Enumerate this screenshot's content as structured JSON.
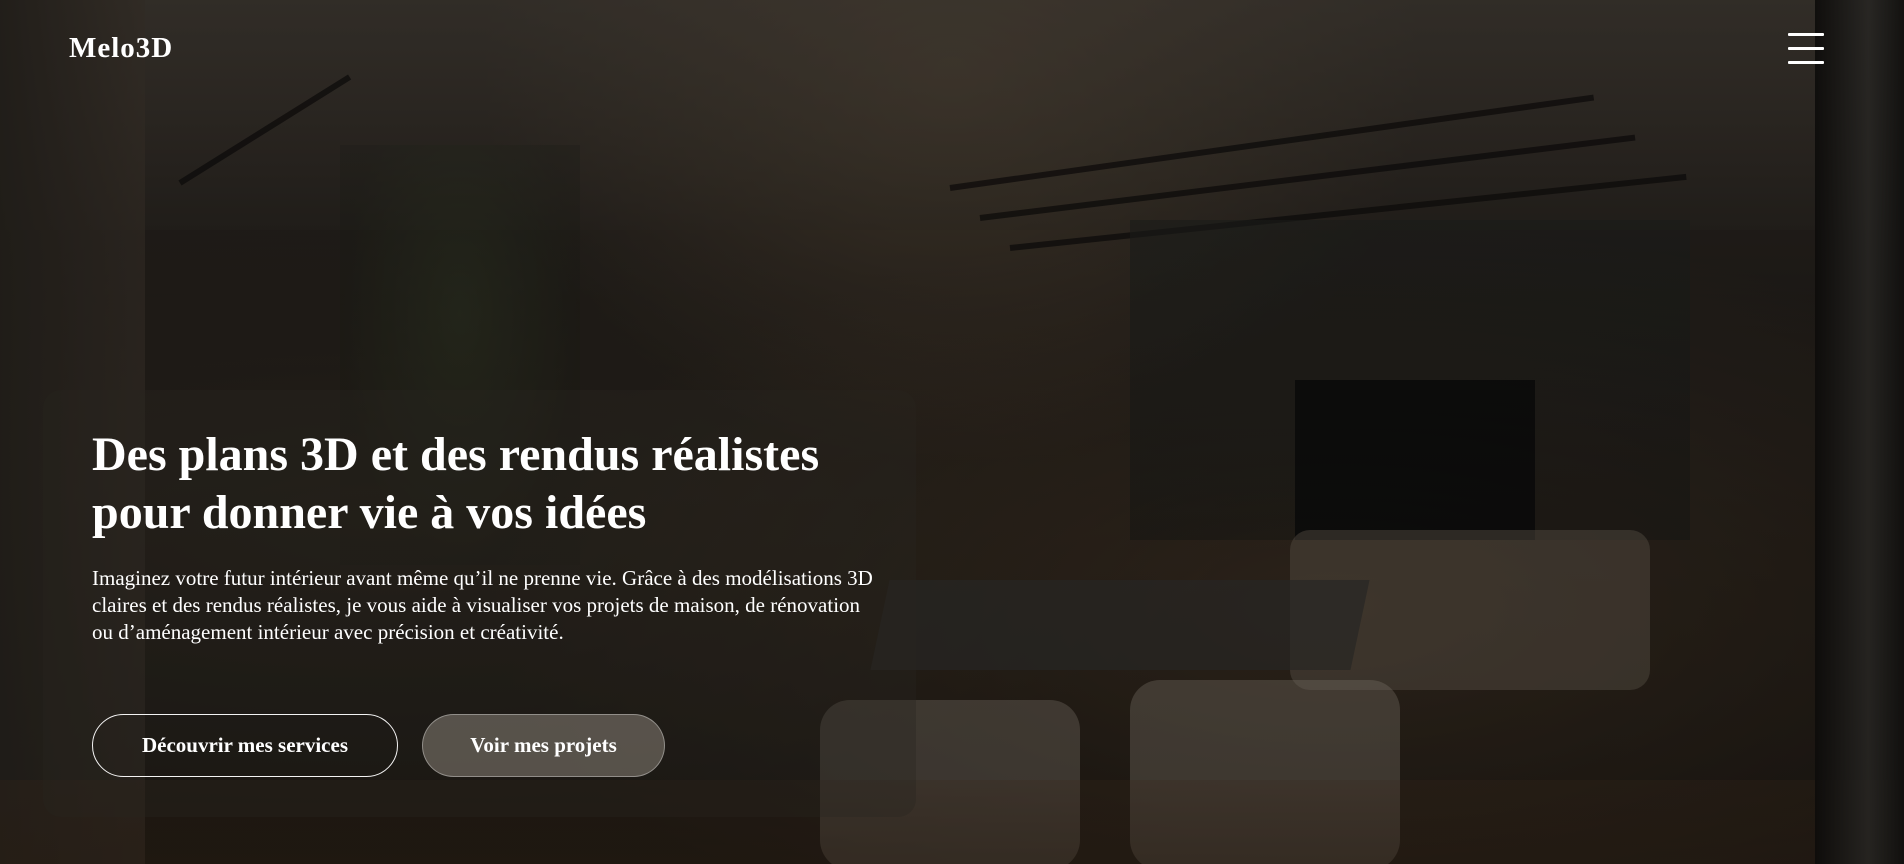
{
  "header": {
    "logo": "Melo3D",
    "menu_icon": "hamburger-menu-icon"
  },
  "hero": {
    "title": "Des plans 3D et des rendus réalistes pour donner vie à vos idées",
    "description": "Imaginez votre futur intérieur avant même qu’il ne prenne vie. Grâce à des modélisations 3D claires et des rendus réalistes, je vous aide à visualiser vos projets de maison, de rénovation ou d’aménagement intérieur avec précision et créativité.",
    "primary_button": "Découvrir mes services",
    "secondary_button": "Voir mes projets"
  },
  "colors": {
    "text": "#ffffff",
    "overlay": "rgba(0,0,0,0.35)"
  }
}
